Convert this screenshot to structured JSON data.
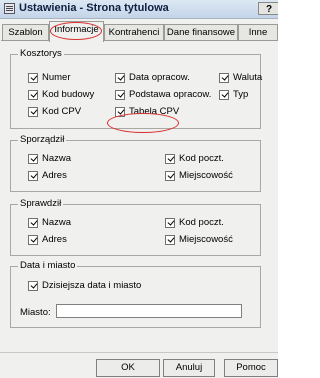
{
  "window": {
    "title": "Ustawienia - Strona tytulowa",
    "help_label": "?"
  },
  "tabs": [
    {
      "label": "Szablon"
    },
    {
      "label": "Informacje"
    },
    {
      "label": "Kontrahenci"
    },
    {
      "label": "Dane finansowe"
    },
    {
      "label": "Inne"
    }
  ],
  "active_tab": "Informacje",
  "groups": {
    "kosztorys": {
      "title": "Kosztorys",
      "items": [
        {
          "label": "Numer",
          "checked": true
        },
        {
          "label": "Data opracow.",
          "checked": true
        },
        {
          "label": "Waluta",
          "checked": true
        },
        {
          "label": "Kod budowy",
          "checked": true
        },
        {
          "label": "Podstawa opracow.",
          "checked": true
        },
        {
          "label": "Typ",
          "checked": true
        },
        {
          "label": "Kod CPV",
          "checked": true
        },
        {
          "label": "Tabela CPV",
          "checked": true
        }
      ]
    },
    "sporzadzil": {
      "title": "Sporządził",
      "items": [
        {
          "label": "Nazwa",
          "checked": true
        },
        {
          "label": "Kod poczt.",
          "checked": true
        },
        {
          "label": "Adres",
          "checked": true
        },
        {
          "label": "Miejscowość",
          "checked": true
        }
      ]
    },
    "sprawdzil": {
      "title": "Sprawdził",
      "items": [
        {
          "label": "Nazwa",
          "checked": true
        },
        {
          "label": "Kod poczt.",
          "checked": true
        },
        {
          "label": "Adres",
          "checked": true
        },
        {
          "label": "Miejscowość",
          "checked": true
        }
      ]
    },
    "data_miasto": {
      "title": "Data i miasto",
      "checkbox": {
        "label": "Dzisiejsza data i miasto",
        "checked": true
      },
      "city_label": "Miasto:",
      "city_value": ""
    }
  },
  "buttons": {
    "ok": "OK",
    "cancel": "Anuluj",
    "help": "Pomoc"
  },
  "colors": {
    "highlight": "#d83030"
  }
}
